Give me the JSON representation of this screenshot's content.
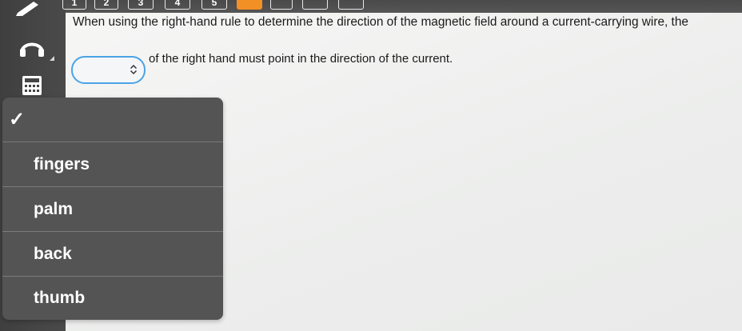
{
  "toolbar": {
    "question_numbers": [
      "1",
      "2",
      "3",
      "4",
      "5",
      "",
      "",
      "",
      ""
    ],
    "active_index": 6
  },
  "sidebar": {
    "icons": [
      "pencil-icon",
      "headphones-icon",
      "calculator-icon"
    ]
  },
  "question": {
    "line1": "When using the right-hand rule to determine the direction of the magnetic field around a current-carrying wire, the",
    "line2_before": "",
    "line2_after": "of the right hand must point in the direction of the current."
  },
  "dropdown": {
    "selected_value": "",
    "options": [
      "fingers",
      "palm",
      "back",
      "thumb"
    ]
  },
  "menu": {
    "check_mark": "✓",
    "items": [
      "fingers",
      "palm",
      "back",
      "thumb"
    ]
  },
  "colors": {
    "accent_orange": "#f29025",
    "focus_blue": "#4aa3e6",
    "menu_bg": "#545454",
    "sidebar_bg": "#444444"
  }
}
